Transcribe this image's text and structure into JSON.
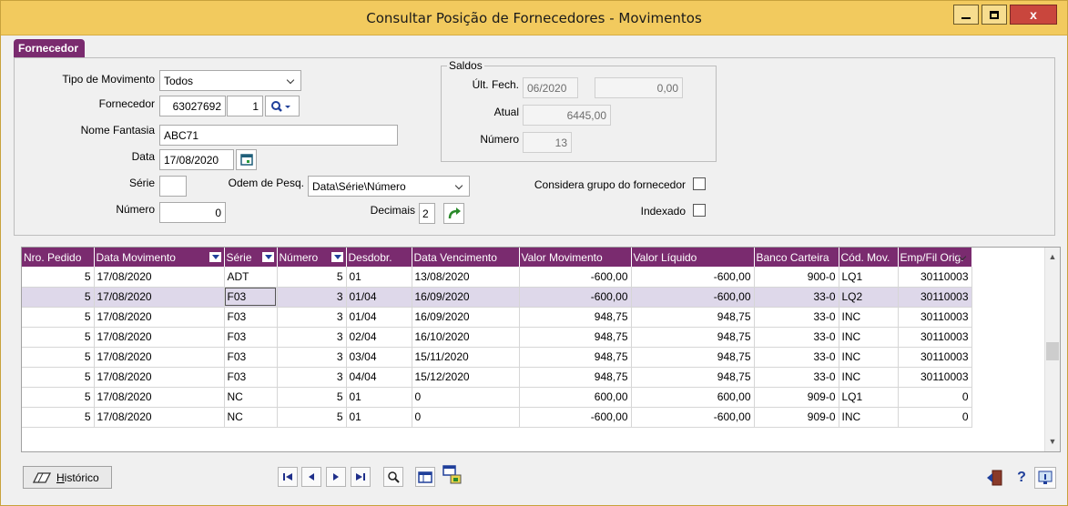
{
  "window": {
    "title": "Consultar Posição de Fornecedores - Movimentos",
    "close_label": "x"
  },
  "tab": {
    "label": "Fornecedor"
  },
  "form": {
    "tipo_movimento_label": "Tipo de Movimento",
    "tipo_movimento_value": "Todos",
    "fornecedor_label": "Fornecedor",
    "fornecedor_code": "63027692",
    "fornecedor_seq": "1",
    "nome_fantasia_label": "Nome Fantasia",
    "nome_fantasia_value": "ABC71",
    "data_label": "Data",
    "data_value": "17/08/2020",
    "serie_label": "Série",
    "serie_value": "",
    "ordem_label": "Odem de Pesq.",
    "ordem_value": "Data\\Série\\Número",
    "numero_label": "Número",
    "numero_value": "0",
    "decimais_label": "Decimais",
    "decimais_value": "2",
    "considera_label": "Considera grupo do fornecedor",
    "indexado_label": "Indexado"
  },
  "saldos": {
    "legend": "Saldos",
    "ult_fech_label": "Últ. Fech.",
    "ult_fech_date": "06/2020",
    "ult_fech_value": "0,00",
    "atual_label": "Atual",
    "atual_value": "6445,00",
    "numero_label": "Número",
    "numero_value": "13"
  },
  "grid": {
    "columns": [
      "Nro. Pedido",
      "Data Movimento",
      "Série",
      "Número",
      "Desdobr.",
      "Data Vencimento",
      "Valor Movimento",
      "Valor Líquido",
      "Banco Carteira",
      "Cód. Mov.",
      "Emp/Fil Orig."
    ],
    "rows": [
      [
        "5",
        "17/08/2020",
        "ADT",
        "5",
        "01",
        "13/08/2020",
        "-600,00",
        "-600,00",
        "900-0",
        "LQ1",
        "30110003"
      ],
      [
        "5",
        "17/08/2020",
        "F03",
        "3",
        "01/04",
        "16/09/2020",
        "-600,00",
        "-600,00",
        "33-0",
        "LQ2",
        "30110003"
      ],
      [
        "5",
        "17/08/2020",
        "F03",
        "3",
        "01/04",
        "16/09/2020",
        "948,75",
        "948,75",
        "33-0",
        "INC",
        "30110003"
      ],
      [
        "5",
        "17/08/2020",
        "F03",
        "3",
        "02/04",
        "16/10/2020",
        "948,75",
        "948,75",
        "33-0",
        "INC",
        "30110003"
      ],
      [
        "5",
        "17/08/2020",
        "F03",
        "3",
        "03/04",
        "15/11/2020",
        "948,75",
        "948,75",
        "33-0",
        "INC",
        "30110003"
      ],
      [
        "5",
        "17/08/2020",
        "F03",
        "3",
        "04/04",
        "15/12/2020",
        "948,75",
        "948,75",
        "33-0",
        "INC",
        "30110003"
      ],
      [
        "5",
        "17/08/2020",
        "NC",
        "5",
        "01",
        "0",
        "600,00",
        "600,00",
        "909-0",
        "LQ1",
        "0"
      ],
      [
        "5",
        "17/08/2020",
        "NC",
        "5",
        "01",
        "0",
        "-600,00",
        "-600,00",
        "909-0",
        "INC",
        "0"
      ]
    ],
    "selected_row": 1
  },
  "bottom": {
    "historico_label_first": "H",
    "historico_label_rest": "istórico"
  },
  "colors": {
    "title_bar": "#f2ca5e",
    "accent": "#7a2b6f",
    "selected_row": "#ded8ea"
  }
}
